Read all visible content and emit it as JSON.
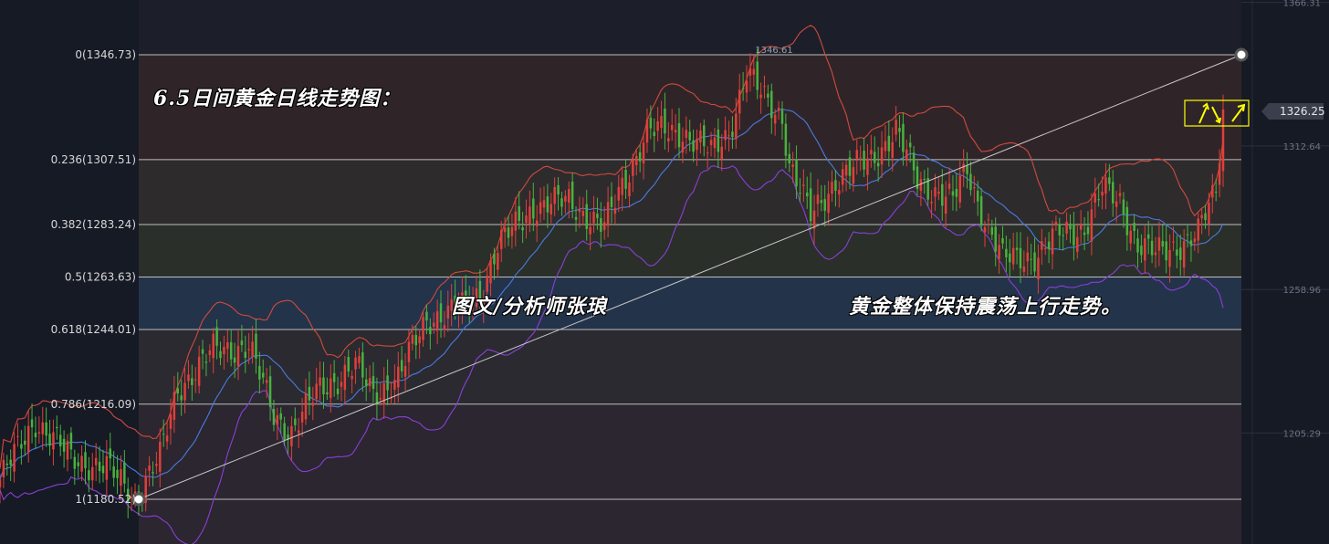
{
  "overlay": {
    "title_note": "6.5日间黄金日线走势图：",
    "author_note": "图文/分析师张琅",
    "trend_note": "黄金整体保持震荡上行走势。"
  },
  "colors": {
    "background": "#161a25",
    "up_candle": "#e0403a",
    "down_candle": "#49b23e",
    "bollinger_upper": "#d24a3d",
    "bollinger_middle": "#4a7bdf",
    "bollinger_lower": "#8a3fd6",
    "fib_line": "#bdbdbd",
    "trendline": "#c8c8c8",
    "highlight_box": "#ffff00"
  },
  "chart_data": {
    "type": "candlestick",
    "title": "",
    "fib_levels": [
      {
        "ratio": "0",
        "price": 1346.73,
        "label": "0(1346.73)"
      },
      {
        "ratio": "0.236",
        "price": 1307.51,
        "label": "0.236(1307.51)"
      },
      {
        "ratio": "0.382",
        "price": 1283.24,
        "label": "0.382(1283.24)"
      },
      {
        "ratio": "0.5",
        "price": 1263.63,
        "label": "0.5(1263.63)"
      },
      {
        "ratio": "0.618",
        "price": 1244.01,
        "label": "0.618(1244.01)"
      },
      {
        "ratio": "0.786",
        "price": 1216.09,
        "label": "0.786(1216.09)"
      },
      {
        "ratio": "1",
        "price": 1180.52,
        "label": "1(1180.52)"
      }
    ],
    "right_axis_ticks": [
      "1366.31",
      "1312.64",
      "1258.96",
      "1205.29"
    ],
    "right_axis_values": [
      1366.31,
      1312.64,
      1258.96,
      1205.29
    ],
    "current_price": {
      "value": 1326.25,
      "label": "1326.25"
    },
    "high_annotation": {
      "value": 1346.61,
      "label": "1346.61"
    },
    "ylim": [
      1163,
      1368
    ],
    "anchors": [
      {
        "t": 0,
        "p": 1188
      },
      {
        "t": 10,
        "p": 1210
      },
      {
        "t": 20,
        "p": 1196
      },
      {
        "t": 30,
        "p": 1192
      },
      {
        "t": 38,
        "p": 1182
      },
      {
        "t": 45,
        "p": 1196
      },
      {
        "t": 50,
        "p": 1222
      },
      {
        "t": 60,
        "p": 1236
      },
      {
        "t": 70,
        "p": 1238
      },
      {
        "t": 77,
        "p": 1212
      },
      {
        "t": 82,
        "p": 1206
      },
      {
        "t": 90,
        "p": 1222
      },
      {
        "t": 100,
        "p": 1230
      },
      {
        "t": 105,
        "p": 1220
      },
      {
        "t": 112,
        "p": 1226
      },
      {
        "t": 120,
        "p": 1248
      },
      {
        "t": 130,
        "p": 1252
      },
      {
        "t": 135,
        "p": 1258
      },
      {
        "t": 140,
        "p": 1275
      },
      {
        "t": 150,
        "p": 1290
      },
      {
        "t": 160,
        "p": 1292
      },
      {
        "t": 170,
        "p": 1282
      },
      {
        "t": 175,
        "p": 1298
      },
      {
        "t": 182,
        "p": 1318
      },
      {
        "t": 192,
        "p": 1318
      },
      {
        "t": 200,
        "p": 1310
      },
      {
        "t": 205,
        "p": 1318
      },
      {
        "t": 210,
        "p": 1340
      },
      {
        "t": 215,
        "p": 1330
      },
      {
        "t": 220,
        "p": 1324
      },
      {
        "t": 222,
        "p": 1306
      },
      {
        "t": 228,
        "p": 1286
      },
      {
        "t": 235,
        "p": 1300
      },
      {
        "t": 245,
        "p": 1308
      },
      {
        "t": 252,
        "p": 1318
      },
      {
        "t": 258,
        "p": 1300
      },
      {
        "t": 268,
        "p": 1292
      },
      {
        "t": 272,
        "p": 1304
      },
      {
        "t": 275,
        "p": 1292
      },
      {
        "t": 282,
        "p": 1270
      },
      {
        "t": 292,
        "p": 1272
      },
      {
        "t": 298,
        "p": 1280
      },
      {
        "t": 305,
        "p": 1282
      },
      {
        "t": 310,
        "p": 1296
      },
      {
        "t": 315,
        "p": 1292
      },
      {
        "t": 320,
        "p": 1276
      },
      {
        "t": 325,
        "p": 1272
      },
      {
        "t": 332,
        "p": 1276
      },
      {
        "t": 337,
        "p": 1280
      },
      {
        "t": 342,
        "p": 1296
      },
      {
        "t": 344,
        "p": 1326
      }
    ]
  }
}
